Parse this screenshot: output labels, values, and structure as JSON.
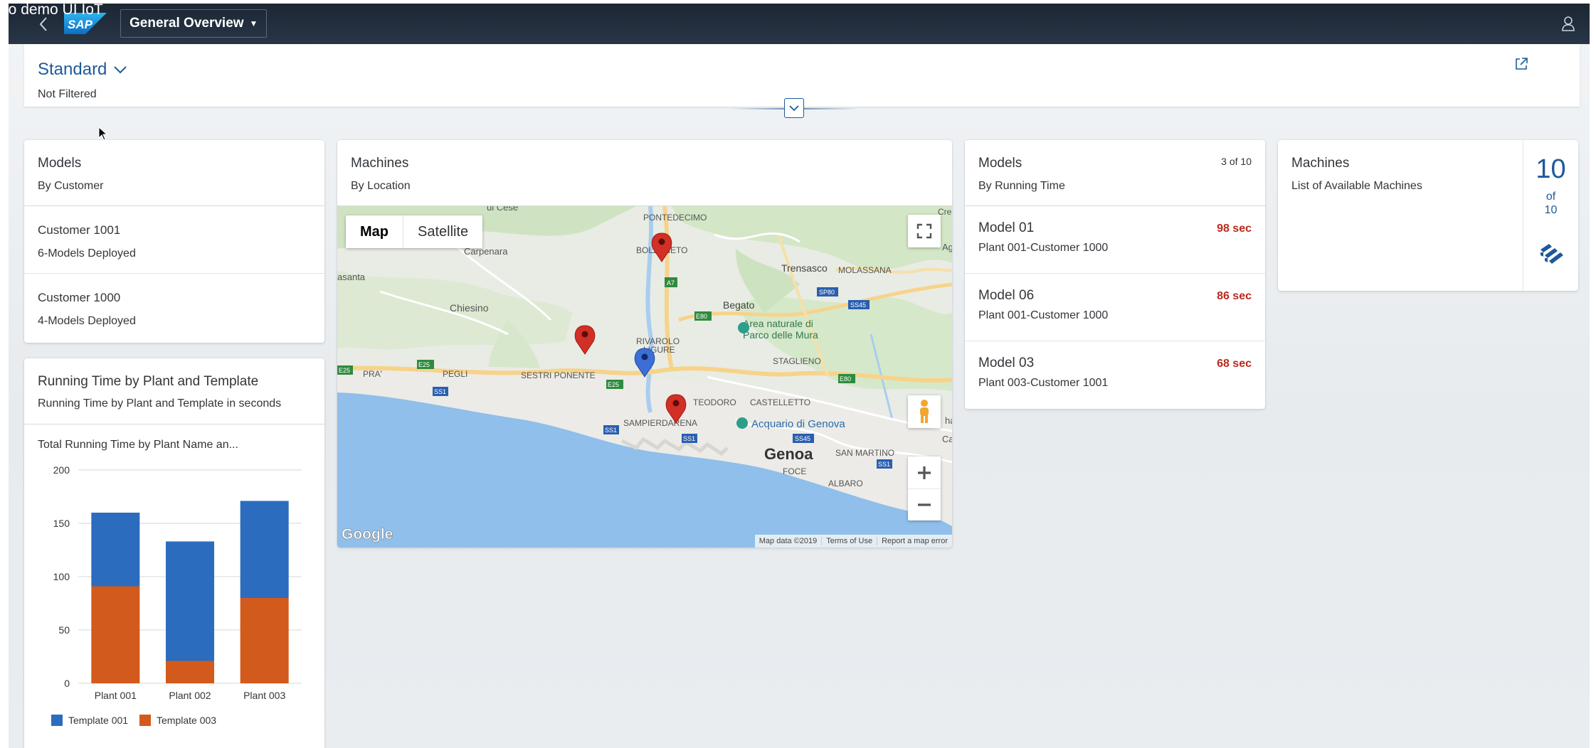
{
  "window": {
    "corner_text": "eo demo UI IoT"
  },
  "shell": {
    "app_title": "General Overview"
  },
  "header": {
    "variant": "Standard",
    "filter_status": "Not Filtered"
  },
  "models_by_customer": {
    "title": "Models",
    "subtitle": "By Customer",
    "items": [
      {
        "title": "Customer 1001",
        "desc": "6-Models Deployed"
      },
      {
        "title": "Customer 1000",
        "desc": "4-Models Deployed"
      }
    ]
  },
  "machines_map": {
    "title": "Machines",
    "subtitle": "By Location",
    "map_type": [
      "Map",
      "Satellite"
    ],
    "labels": {
      "pontedecimo": "PONTEDECIMO",
      "carpenara": "Carpenara",
      "chiesino": "Chiesino",
      "trensasco": "Trensasco",
      "molassana": "MOLASSANA",
      "begato": "Begato",
      "parco": "Area naturale di",
      "parco2": "Parco delle Mura",
      "staglieno": "STAGLIENO",
      "pra": "PRA'",
      "pegli": "PEGLI",
      "sestri": "SESTRI PONENTE",
      "teodoro": "TEODORO",
      "castelletto": "CASTELLETTO",
      "acquario": "Acquario di Genova",
      "sampierdarena": "SAMPIERDARENA",
      "genoa": "Genoa",
      "foce": "FOCE",
      "san_martino": "SAN MARTINO",
      "albaro": "ALBARO",
      "bolzaneto": "BOLZANETO",
      "rivarolo": "RIVAROLO",
      "rivarolo2": "LIGURE",
      "asanta": "asanta",
      "urcese": "ui Cese",
      "cre": "Cre",
      "ag": "Ag",
      "caru": "Caru",
      "ha": "ha",
      "r_a7": "A7",
      "r_e80": "E80",
      "r_sp80": "SP80",
      "r_ss45": "SS45",
      "r_e25": "E25",
      "r_ss1": "SS1",
      "r_e80b": "E80",
      "r_e25b": "E25",
      "r_ss1b": "SS1",
      "r_ss1c": "SS1",
      "r_ss45b": "SS45",
      "r_ss1d": "SS1",
      "r_e25c": "E25"
    },
    "google": "Google",
    "attribution": [
      "Map data ©2019",
      "Terms of Use",
      "Report a map error"
    ]
  },
  "models_running_time": {
    "title": "Models",
    "subtitle": "By Running Time",
    "count": "3 of 10",
    "items": [
      {
        "title": "Model 01",
        "desc": "Plant 001-Customer 1000",
        "value": "98 sec"
      },
      {
        "title": "Model 06",
        "desc": "Plant 001-Customer 1000",
        "value": "86 sec"
      },
      {
        "title": "Model 03",
        "desc": "Plant 003-Customer 1001",
        "value": "68 sec"
      }
    ]
  },
  "machines_list": {
    "title": "Machines",
    "subtitle": "List of Available Machines",
    "kpi": "10",
    "kpi_of": "of",
    "kpi_total": "10"
  },
  "running_time_card": {
    "title": "Running Time by Plant and Template",
    "subtitle": "Running Time by Plant and Template in seconds",
    "chart_title": "Total Running Time by Plant Name an..."
  },
  "colors": {
    "template_001": "#2b6cbf",
    "template_003": "#d15a1c",
    "accent": "#1d5a99",
    "negative": "#bb2a1c"
  },
  "chart_data": {
    "type": "bar",
    "stacked": true,
    "title": "Total Running Time by Plant Name an...",
    "categories": [
      "Plant 001",
      "Plant 002",
      "Plant 003"
    ],
    "series": [
      {
        "name": "Template 003",
        "values": [
          91,
          21,
          80
        ]
      },
      {
        "name": "Template 001",
        "values": [
          69,
          112,
          91
        ]
      }
    ],
    "ylim": [
      0,
      200
    ],
    "yticks": [
      0,
      50,
      100,
      150,
      200
    ],
    "grid": true,
    "legend": "bottom"
  }
}
